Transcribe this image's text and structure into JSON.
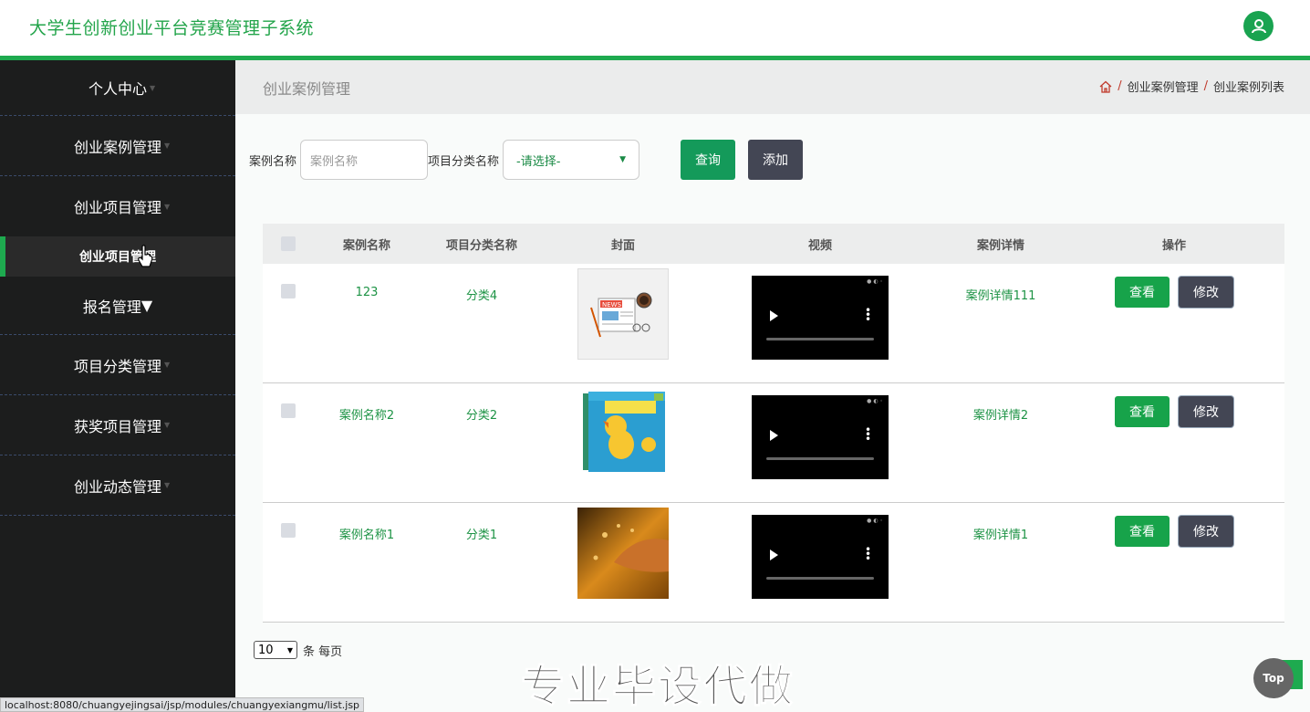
{
  "header": {
    "title": "大学生创新创业平台竞赛管理子系统",
    "avatar_icon": "user-icon"
  },
  "sidebar": {
    "items": [
      {
        "label": "个人中心"
      },
      {
        "label": "创业案例管理"
      },
      {
        "label": "创业项目管理"
      }
    ],
    "sub_items": [
      {
        "label": "创业项目管理"
      },
      {
        "label": "报名管理"
      }
    ],
    "items_after": [
      {
        "label": "项目分类管理"
      },
      {
        "label": "获奖项目管理"
      },
      {
        "label": "创业动态管理"
      }
    ]
  },
  "page": {
    "title": "创业案例管理",
    "breadcrumb": [
      "创业案例管理",
      "创业案例列表"
    ]
  },
  "search": {
    "name_label": "案例名称",
    "name_placeholder": "案例名称",
    "category_label": "项目分类名称",
    "category_selected": "-请选择-",
    "search_button": "查询",
    "add_button": "添加"
  },
  "table": {
    "headers": [
      "案例名称",
      "项目分类名称",
      "封面",
      "视频",
      "案例详情",
      "操作"
    ],
    "rows": [
      {
        "name": "123",
        "category": "分类4",
        "cover": "news-cover",
        "detail": "案例详情111",
        "view": "查看",
        "edit": "修改"
      },
      {
        "name": "案例名称2",
        "category": "分类2",
        "cover": "book-cover",
        "detail": "案例详情2",
        "view": "查看",
        "edit": "修改"
      },
      {
        "name": "案例名称1",
        "category": "分类1",
        "cover": "tablet-cover",
        "detail": "案例详情1",
        "view": "查看",
        "edit": "修改"
      }
    ]
  },
  "pager": {
    "page_size": "10",
    "suffix": "条 每页"
  },
  "watermark": "专业毕设代做",
  "top_button": "Top",
  "status_url": "localhost:8080/chuangyejingsai/jsp/modules/chuangyexiangmu/list.jsp",
  "colors": {
    "brand": "#1eaa4f",
    "sidebar": "#1c1d1d",
    "dark_button": "#434654"
  }
}
